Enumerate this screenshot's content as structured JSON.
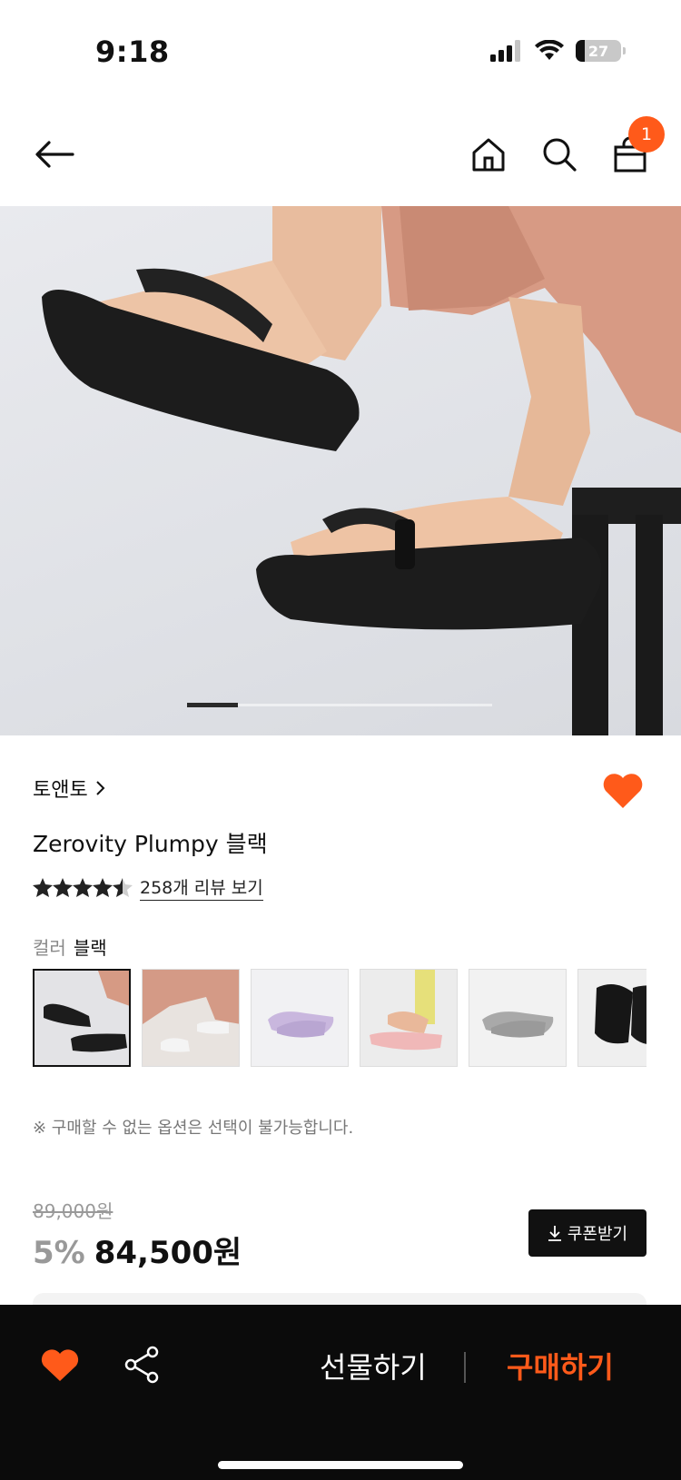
{
  "status_bar": {
    "time": "9:18",
    "battery": "27",
    "icons": [
      "signal-icon",
      "wifi-icon",
      "battery-icon"
    ]
  },
  "header": {
    "icons": [
      "back-arrow-icon",
      "home-icon",
      "search-icon",
      "shopping-bag-icon"
    ],
    "cart_count": "1"
  },
  "hero": {
    "slide_indicator": {
      "current": 1,
      "total": 6
    }
  },
  "product": {
    "brand": "토앤토",
    "name": "Zerovity Plumpy 블랙",
    "rating_stars": 4.5,
    "review_text": "258개 리뷰 보기",
    "color_label": "컬러",
    "color_value": "블랙",
    "swatches": [
      {
        "color": "black",
        "selected": true
      },
      {
        "color": "white",
        "selected": false
      },
      {
        "color": "lavender",
        "selected": false
      },
      {
        "color": "pink",
        "selected": false
      },
      {
        "color": "gray",
        "selected": false
      },
      {
        "color": "black-box",
        "selected": false
      }
    ],
    "notice": "※ 구매할 수 없는 옵션은 선택이 불가능합니다.",
    "original_price": "89,000원",
    "discount": "5%",
    "sale_price": "84,500원",
    "coupon_label": "쿠폰받기"
  },
  "bottom_bar": {
    "gift_label": "선물하기",
    "buy_label": "구매하기"
  },
  "colors": {
    "accent": "#ff5a1a",
    "bottom_bar_bg": "#0b0b0b",
    "heart": "#ff5a1a"
  }
}
